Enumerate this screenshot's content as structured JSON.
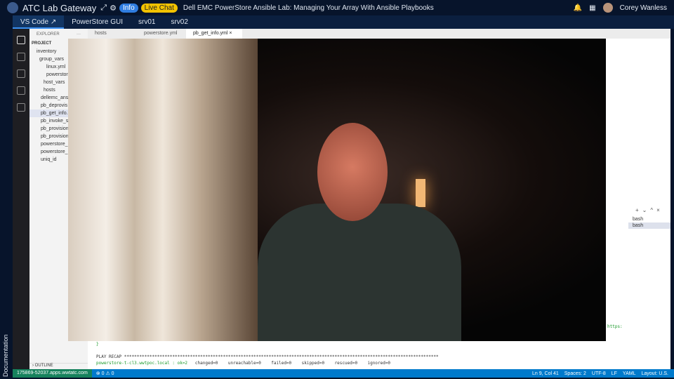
{
  "topbar": {
    "title": "ATC Lab Gateway",
    "info": "Info",
    "live_chat": "Live Chat",
    "lab_title": "Dell EMC PowerStore Ansible Lab: Managing Your Array With Ansible Playbooks",
    "user": "Corey Wanless"
  },
  "tabs": [
    {
      "label": "VS Code"
    },
    {
      "label": "PowerStore GUI"
    },
    {
      "label": "srv01"
    },
    {
      "label": "srv02"
    }
  ],
  "sidebar": {
    "documentation": "Documentation"
  },
  "explorer": {
    "header": "EXPLORER",
    "project": "PROJECT",
    "outline": "OUTLINE",
    "items": [
      "inventory",
      "group_vars",
      "linux.yml",
      "powerstore",
      "host_vars",
      "hosts",
      "dellemc_ans",
      "pb_deprovis",
      "pb_get_info.",
      "pb_invoke_s",
      "pb_provision",
      "pb_provision",
      "powerstore_",
      "powerstore_",
      "uniq_id"
    ]
  },
  "editor_tabs": [
    {
      "label": "hosts"
    },
    {
      "label": "powerstore.yml"
    },
    {
      "label": "pb_get_info.yml"
    }
  ],
  "terminal": {
    "lines": [
      "PLAY RECAP ****************************************************************************************************************************"
    ],
    "host": "powerstore-t-cl3.wwtpoc.local : ok=2",
    "stats": "changed=0    unreachable=0    failed=0    skipped=0    rescued=0    ignored=0",
    "url_fragment": "https:",
    "brace": "}",
    "shells": [
      "bash",
      "bash"
    ]
  },
  "status": {
    "remote": "175869-52037.apps.wwtatc.com",
    "problems": "⊗ 0 ⚠ 0",
    "ln": "Ln 9, Col 41",
    "spaces": "Spaces: 2",
    "enc": "UTF-8",
    "eol": "LF",
    "lang": "YAML",
    "layout": "Layout: U.S."
  }
}
